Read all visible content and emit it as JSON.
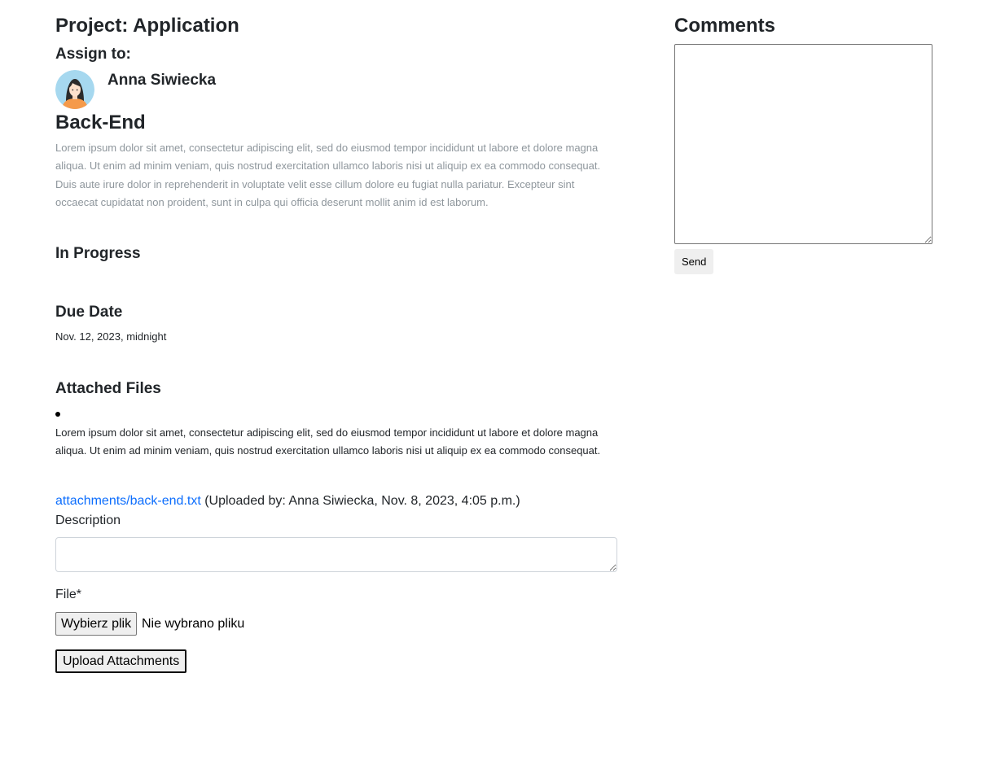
{
  "project": {
    "title": "Project: Application",
    "assign_label": "Assign to:",
    "assignee_name": "Anna Siwiecka"
  },
  "task": {
    "name": "Back-End",
    "description": "Lorem ipsum dolor sit amet, consectetur adipiscing elit, sed do eiusmod tempor incididunt ut labore et dolore magna aliqua. Ut enim ad minim veniam, quis nostrud exercitation ullamco laboris nisi ut aliquip ex ea commodo consequat. Duis aute irure dolor in reprehenderit in voluptate velit esse cillum dolore eu fugiat nulla pariatur. Excepteur sint occaecat cupidatat non proident, sunt in culpa qui officia deserunt mollit anim id est laborum.",
    "status": "In Progress",
    "due_label": "Due Date",
    "due_value": "Nov. 12, 2023, midnight"
  },
  "attachments": {
    "heading": "Attached Files",
    "items": [
      {
        "description": "Lorem ipsum dolor sit amet, consectetur adipiscing elit, sed do eiusmod tempor incididunt ut labore et dolore magna aliqua. Ut enim ad minim veniam, quis nostrud exercitation ullamco laboris nisi ut aliquip ex ea commodo consequat.",
        "link_text": "attachments/back-end.txt",
        "meta": "(Uploaded by: Anna Siwiecka, Nov. 8, 2023, 4:05 p.m.)"
      }
    ]
  },
  "upload_form": {
    "description_label": "Description",
    "description_value": "",
    "file_label": "File*",
    "choose_button": "Wybierz plik",
    "no_file_text": "Nie wybrano pliku",
    "submit_label": "Upload Attachments"
  },
  "comments": {
    "heading": "Comments",
    "textarea_value": "",
    "send_label": "Send"
  },
  "colors": {
    "text": "#212529",
    "muted_text": "#8e969c",
    "link": "#0d6efd",
    "button_bg": "#efefef",
    "avatar_bg": "#a6d8ef",
    "avatar_shirt": "#f59a4a"
  },
  "icons": {
    "avatar": "female-user-avatar-icon"
  }
}
